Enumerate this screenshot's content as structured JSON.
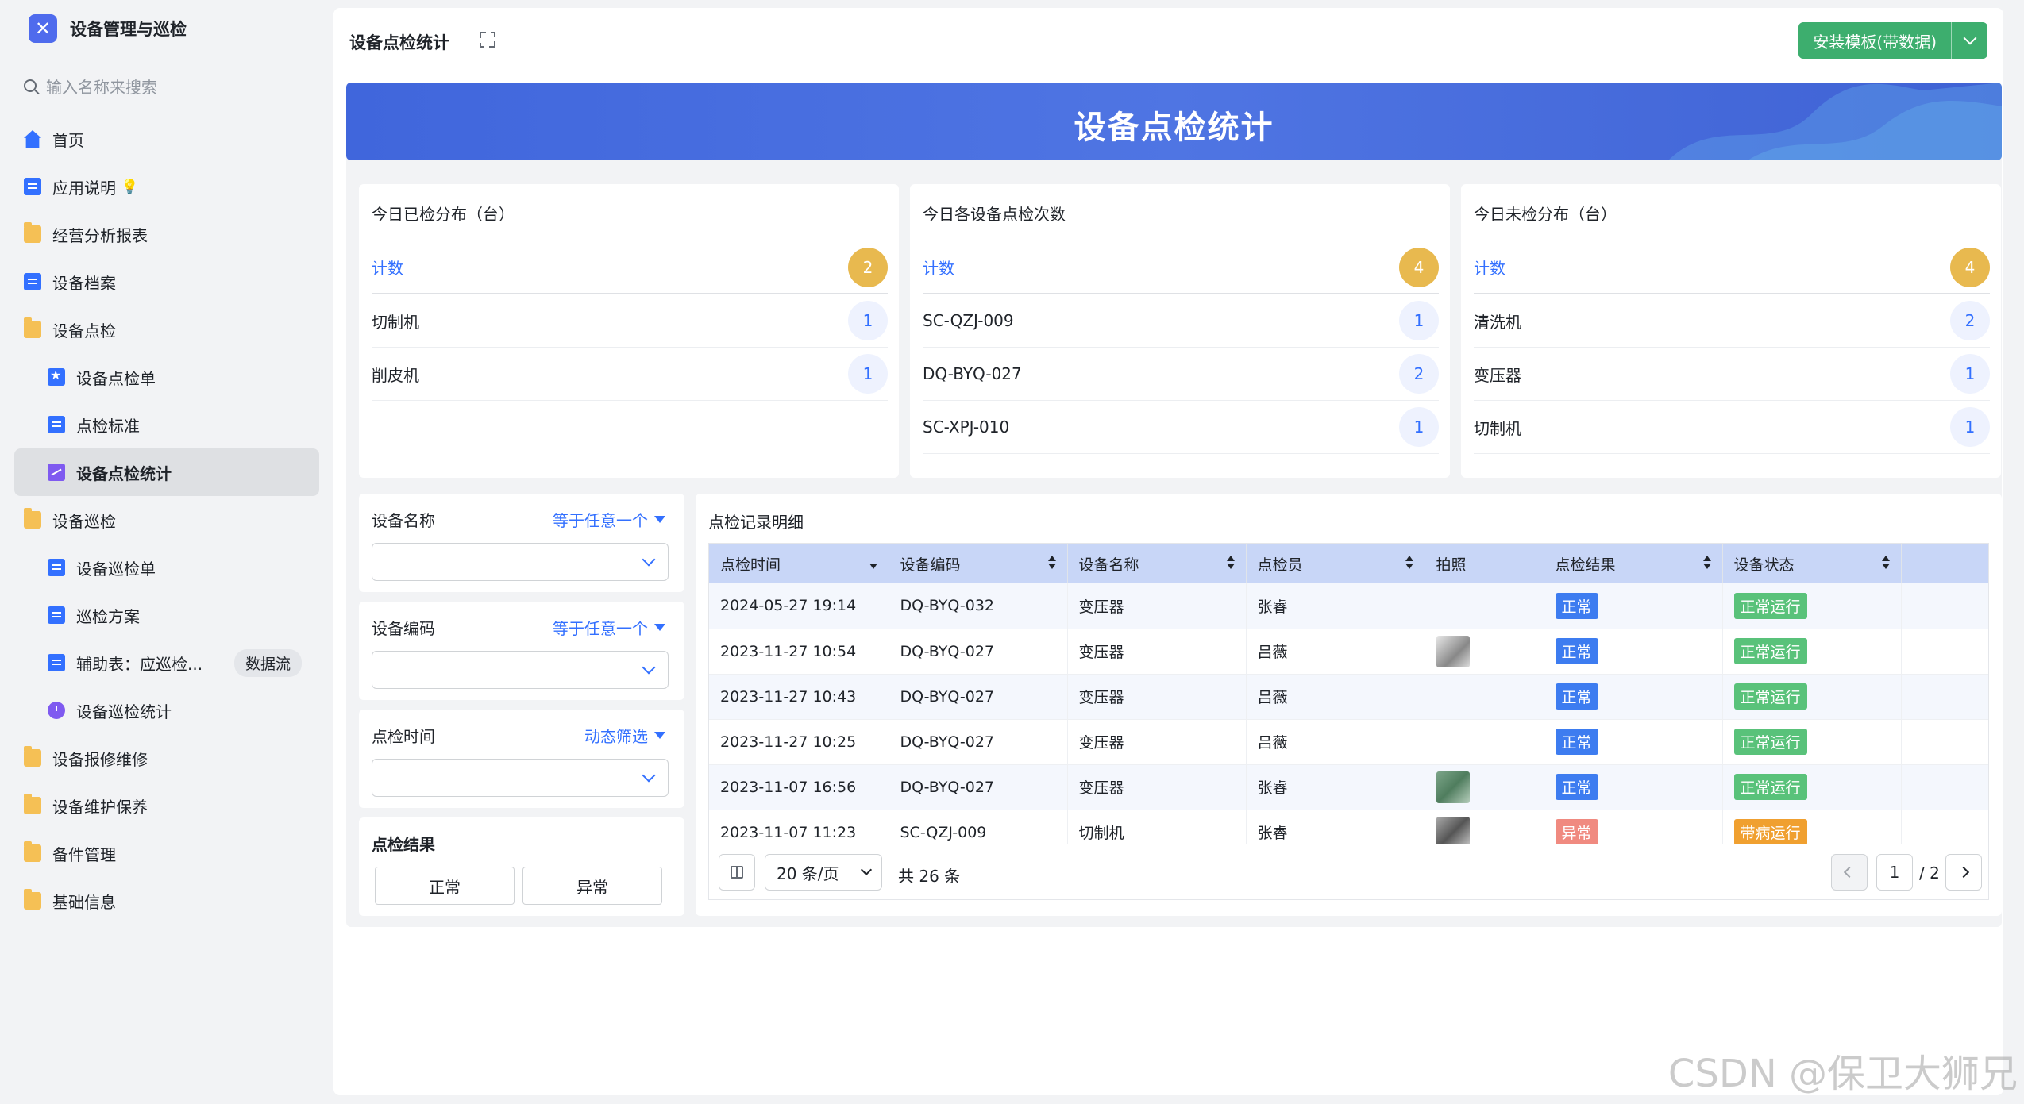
{
  "app": {
    "title": "设备管理与巡检",
    "search_placeholder": "输入名称来搜索"
  },
  "sidebar": {
    "items": [
      {
        "label": "首页",
        "icon": "home-icon"
      },
      {
        "label": "应用说明",
        "icon": "doc-icon",
        "suffix": "💡"
      },
      {
        "label": "经营分析报表",
        "icon": "folder-icon"
      },
      {
        "label": "设备档案",
        "icon": "doc-icon"
      },
      {
        "label": "设备点检",
        "icon": "folder-open-icon"
      },
      {
        "label": "设备点检单",
        "icon": "star-icon"
      },
      {
        "label": "点检标准",
        "icon": "doc-icon"
      },
      {
        "label": "设备点检统计",
        "icon": "chart-icon"
      },
      {
        "label": "设备巡检",
        "icon": "folder-open-icon"
      },
      {
        "label": "设备巡检单",
        "icon": "doc-icon"
      },
      {
        "label": "巡检方案",
        "icon": "doc-icon"
      },
      {
        "label": "辅助表：应巡检...",
        "icon": "doc-icon",
        "badge": "数据流"
      },
      {
        "label": "设备巡检统计",
        "icon": "clock-icon"
      },
      {
        "label": "设备报修维修",
        "icon": "folder-icon"
      },
      {
        "label": "设备维护保养",
        "icon": "folder-icon"
      },
      {
        "label": "备件管理",
        "icon": "folder-icon"
      },
      {
        "label": "基础信息",
        "icon": "folder-icon"
      }
    ]
  },
  "header": {
    "title": "设备点检统计",
    "install_label": "安装模板(带数据)"
  },
  "banner": {
    "title": "设备点检统计"
  },
  "stats": [
    {
      "title": "今日已检分布（台）",
      "head_label": "计数",
      "head_value": "2",
      "rows": [
        {
          "label": "切制机",
          "value": "1"
        },
        {
          "label": "削皮机",
          "value": "1"
        }
      ]
    },
    {
      "title": "今日各设备点检次数",
      "head_label": "计数",
      "head_value": "4",
      "rows": [
        {
          "label": "SC-QZJ-009",
          "value": "1"
        },
        {
          "label": "DQ-BYQ-027",
          "value": "2"
        },
        {
          "label": "SC-XPJ-010",
          "value": "1"
        }
      ]
    },
    {
      "title": "今日未检分布（台）",
      "head_label": "计数",
      "head_value": "4",
      "rows": [
        {
          "label": "清洗机",
          "value": "2"
        },
        {
          "label": "变压器",
          "value": "1"
        },
        {
          "label": "切制机",
          "value": "1"
        }
      ]
    }
  ],
  "filters": {
    "device_name": {
      "label": "设备名称",
      "op": "等于任意一个"
    },
    "device_code": {
      "label": "设备编码",
      "op": "等于任意一个"
    },
    "check_time": {
      "label": "点检时间",
      "op": "动态筛选"
    },
    "result": {
      "label": "点检结果",
      "options": [
        "正常",
        "异常"
      ]
    }
  },
  "detail": {
    "title": "点检记录明细",
    "columns": [
      "点检时间",
      "设备编码",
      "设备名称",
      "点检员",
      "拍照",
      "点检结果",
      "设备状态"
    ],
    "rows": [
      {
        "time": "2024-05-27 19:14",
        "code": "DQ-BYQ-032",
        "name": "变压器",
        "inspector": "张睿",
        "photo": "",
        "result": "正常",
        "status": "正常运行"
      },
      {
        "time": "2023-11-27 10:54",
        "code": "DQ-BYQ-027",
        "name": "变压器",
        "inspector": "吕薇",
        "photo": "gray",
        "result": "正常",
        "status": "正常运行"
      },
      {
        "time": "2023-11-27 10:43",
        "code": "DQ-BYQ-027",
        "name": "变压器",
        "inspector": "吕薇",
        "photo": "",
        "result": "正常",
        "status": "正常运行"
      },
      {
        "time": "2023-11-27 10:25",
        "code": "DQ-BYQ-027",
        "name": "变压器",
        "inspector": "吕薇",
        "photo": "",
        "result": "正常",
        "status": "正常运行"
      },
      {
        "time": "2023-11-07 16:56",
        "code": "DQ-BYQ-027",
        "name": "变压器",
        "inspector": "张睿",
        "photo": "green",
        "result": "正常",
        "status": "正常运行"
      },
      {
        "time": "2023-11-07 11:23",
        "code": "SC-QZJ-009",
        "name": "切制机",
        "inspector": "张睿",
        "photo": "dark",
        "result": "异常",
        "status": "带病运行"
      }
    ],
    "pager": {
      "page_size": "20 条/页",
      "total": "共 26 条",
      "current": "1",
      "pages": "/ 2"
    }
  },
  "colors": {
    "accent": "#3370ff",
    "install": "#3dae6e",
    "banner": "#4066dc",
    "count_pill": "#e8b94f"
  },
  "watermark": "CSDN @保卫大狮兄"
}
